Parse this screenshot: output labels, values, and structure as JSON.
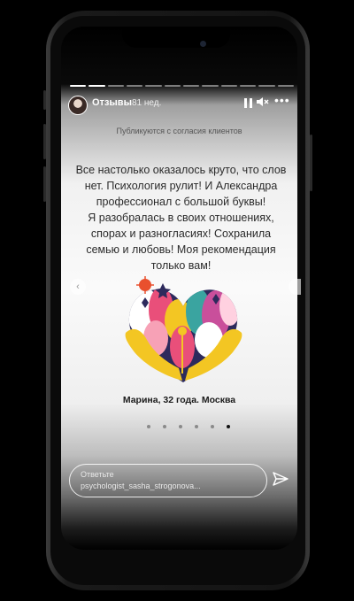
{
  "story": {
    "account_name": "Отзывы",
    "time_ago": "81 нед.",
    "segments_total": 12,
    "segments_viewed": 2,
    "more_label": "•••"
  },
  "content": {
    "caption": "Публикуются с согласия клиентов",
    "review_lines": [
      "Все настолько оказалось круто, что слов",
      "нет. Психология рулит! И Александра",
      "профессионал с большой буквы!",
      "Я разобралась в своих отношениях,",
      "спорах и разногласиях! Сохранила",
      "семью и любовь! Моя рекомендация",
      "только вам!"
    ],
    "author": "Марина, 32 года. Москва",
    "carousel_count": 6,
    "carousel_active": 6
  },
  "reply": {
    "line1": "Ответьте",
    "line2": "psychologist_sasha_strogonova..."
  },
  "icons": {
    "pause": "pause-icon",
    "mute": "speaker-muted-icon",
    "more": "more-dots-icon",
    "send": "send-icon",
    "prev": "chevron-left-icon"
  },
  "colors": {
    "progress_filled": "#ffffff",
    "text_dark": "#2b2b2b",
    "illustration_yellow": "#f3c623",
    "illustration_pink": "#e94f7a",
    "illustration_navy": "#2d2a5c"
  }
}
